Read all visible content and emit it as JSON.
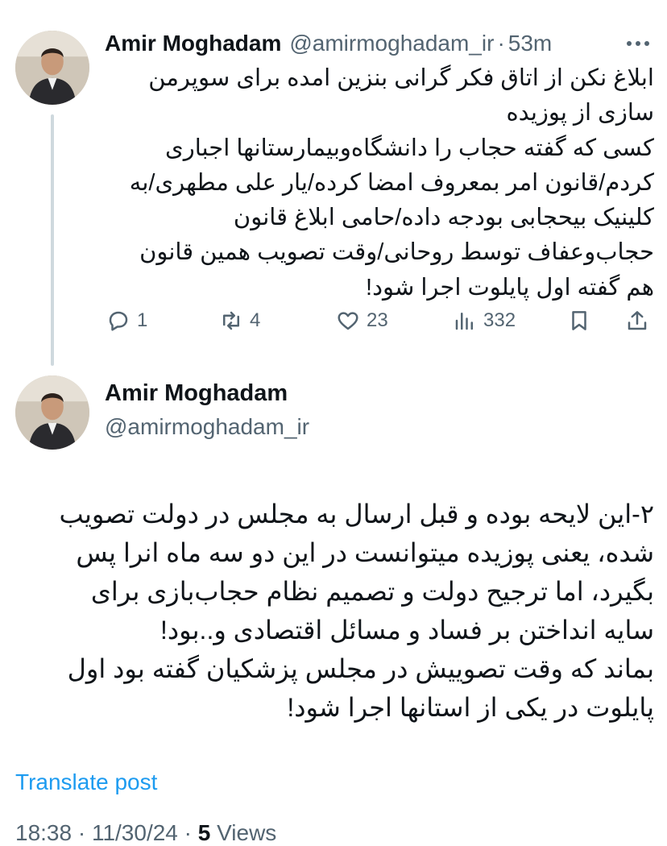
{
  "tweet1": {
    "author_name": "Amir Moghadam",
    "handle": "@amirmoghadam_ir",
    "separator": "·",
    "time": "53m",
    "text": "ابلاغ نکن از اتاق فکر گرانی بنزین امده برای سوپرمن\nسازی از پوزیده\nکسی که گفته حجاب را دانشگاه‌وبیمارستانها اجباری\nکردم/قانون امر بمعروف امضا کرده/یار علی مطهری/به\nکلینیک بیحجابی بودجه داده/حامی ابلاغ قانون\nحجاب‌وعفاف توسط روحانی/وقت تصویب همین قانون\nهم گفته اول پایلوت اجرا شود!",
    "replies": "1",
    "reposts": "4",
    "likes": "23",
    "views": "332"
  },
  "tweet2": {
    "author_name": "Amir Moghadam",
    "handle": "@amirmoghadam_ir",
    "text": "۲-این لایحه بوده و قبل ارسال به مجلس در دولت تصویب\nشده، یعنی پوزیده میتوانست در این دو سه ماه انرا پس\nبگیرد، اما ترجیح دولت و تصمیم نظام حجاب‌بازی برای\nسایه انداختن بر فساد و مسائل اقتصادی و..بود!\nبماند که وقت تصوییش در مجلس پزشکیان گفته بود اول\nپایلوت در یکی از استانها اجرا شود!",
    "translate_label": "Translate post",
    "timestamp": "18:38 · 11/30/24 · ",
    "views_count": "5",
    "views_label": " Views"
  },
  "icons": [
    "more-icon",
    "reply-icon",
    "repost-icon",
    "like-icon",
    "views-icon",
    "bookmark-icon",
    "share-icon"
  ],
  "colors": {
    "text": "#0f1419",
    "secondary": "#536471",
    "link": "#1d9bf0",
    "thread_line": "#cfd9de"
  }
}
